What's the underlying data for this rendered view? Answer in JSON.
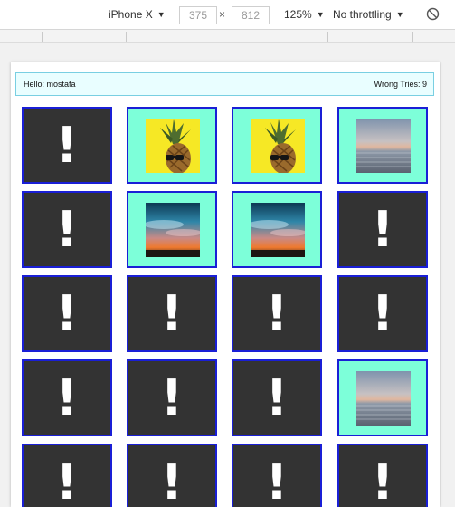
{
  "devtools": {
    "device": "iPhone X",
    "width": "375",
    "height": "812",
    "separator": "×",
    "zoom": "125%",
    "throttling": "No throttling"
  },
  "header": {
    "greeting": "Hello: mostafa",
    "tries": "Wrong Tries: 9"
  },
  "cards": [
    {
      "state": "hidden",
      "image": "",
      "symbol": "!"
    },
    {
      "state": "revealed",
      "image": "pineapple",
      "symbol": ""
    },
    {
      "state": "revealed",
      "image": "pineapple",
      "symbol": ""
    },
    {
      "state": "revealed",
      "image": "calm-sea",
      "symbol": ""
    },
    {
      "state": "hidden",
      "image": "",
      "symbol": "!"
    },
    {
      "state": "revealed",
      "image": "sunset-sky",
      "symbol": ""
    },
    {
      "state": "revealed",
      "image": "sunset-sky",
      "symbol": ""
    },
    {
      "state": "hidden",
      "image": "",
      "symbol": "!"
    },
    {
      "state": "hidden",
      "image": "",
      "symbol": "!"
    },
    {
      "state": "hidden",
      "image": "",
      "symbol": "!"
    },
    {
      "state": "hidden",
      "image": "",
      "symbol": "!"
    },
    {
      "state": "hidden",
      "image": "",
      "symbol": "!"
    },
    {
      "state": "hidden",
      "image": "",
      "symbol": "!"
    },
    {
      "state": "hidden",
      "image": "",
      "symbol": "!"
    },
    {
      "state": "hidden",
      "image": "",
      "symbol": "!"
    },
    {
      "state": "revealed",
      "image": "calm-sea",
      "symbol": ""
    },
    {
      "state": "hidden",
      "image": "",
      "symbol": "!"
    },
    {
      "state": "hidden",
      "image": "",
      "symbol": "!"
    },
    {
      "state": "hidden",
      "image": "",
      "symbol": "!"
    },
    {
      "state": "hidden",
      "image": "",
      "symbol": "!"
    }
  ],
  "colors": {
    "card_back": "#333333",
    "card_front": "#7dffd9",
    "card_border": "#1a1fd6",
    "header_bg": "#e9feff",
    "header_border": "#79cfe2"
  }
}
